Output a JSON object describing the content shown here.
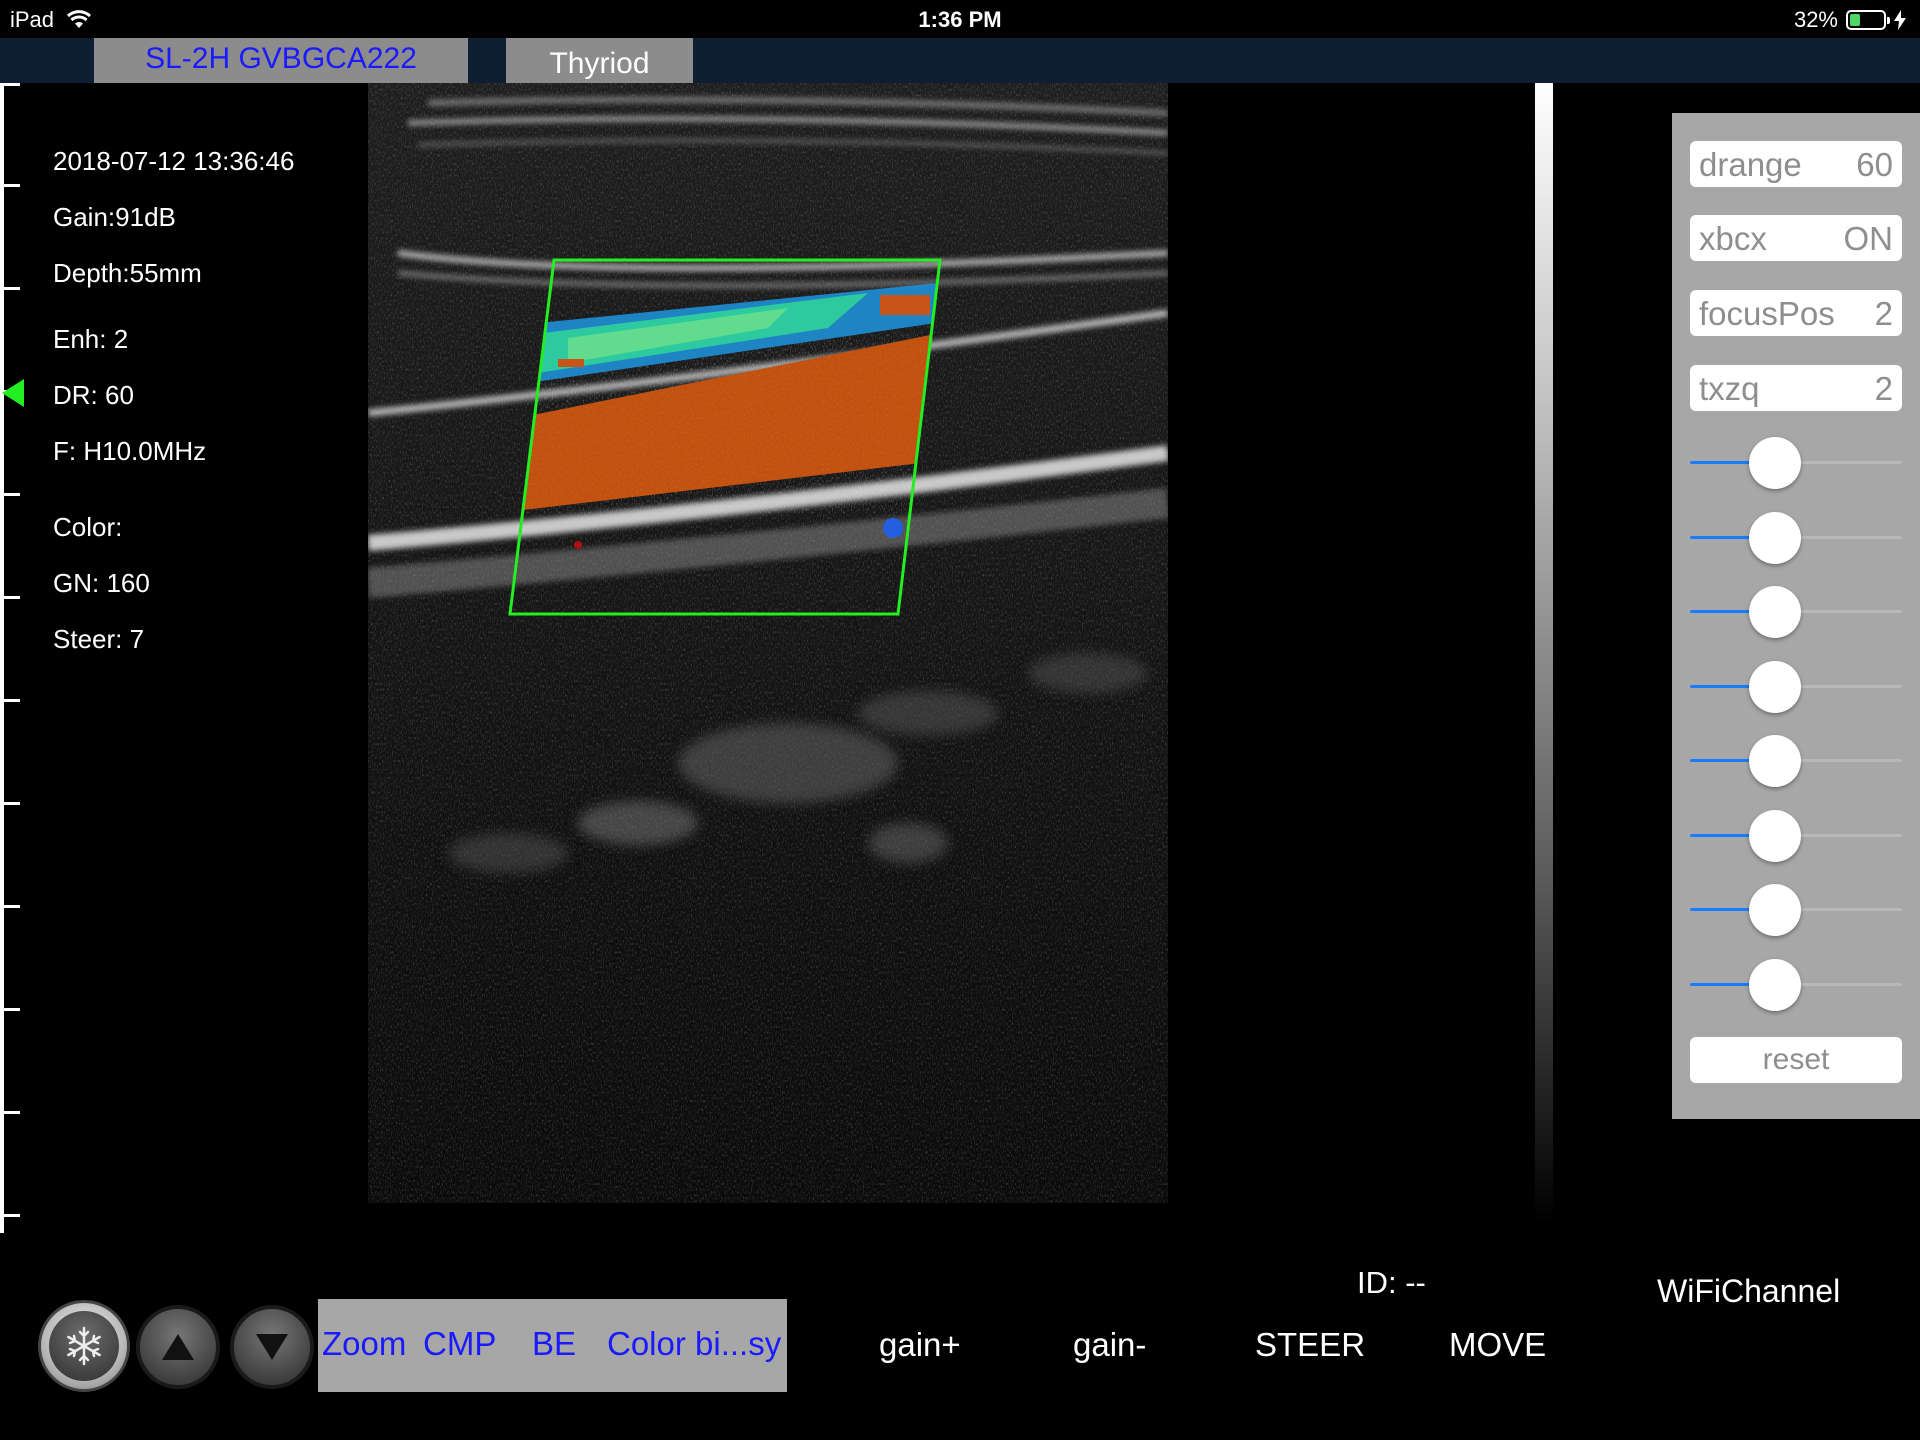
{
  "status_bar": {
    "device": "iPad",
    "time": "1:36 PM",
    "battery_percent": "32%",
    "battery_level": 0.32,
    "wifi_icon": "wifi-icon",
    "charging_icon": "bolt-icon"
  },
  "tabs": {
    "probe": "SL-2H GVBGCA222",
    "preset": "Thyriod"
  },
  "info": {
    "datetime": "2018-07-12 13:36:46",
    "gain": "Gain:91dB",
    "depth": "Depth:55mm",
    "enh": "Enh: 2",
    "dr": "DR: 60",
    "freq": "F: H10.0MHz",
    "color": "Color:",
    "gn": "GN: 160",
    "steer": "Steer: 7"
  },
  "panel": {
    "params": [
      {
        "label": "drange",
        "value": "60"
      },
      {
        "label": "xbcx",
        "value": "ON"
      },
      {
        "label": "focusPos",
        "value": "2"
      },
      {
        "label": "txzq",
        "value": "2"
      }
    ],
    "sliders": [
      0.4,
      0.4,
      0.4,
      0.4,
      0.4,
      0.4,
      0.4,
      0.4
    ],
    "reset_label": "reset"
  },
  "bottom": {
    "freeze_icon": "snowflake-icon",
    "up_icon": "triangle-up-icon",
    "down_icon": "triangle-down-icon",
    "modes": [
      "Zoom",
      "CMP",
      "BE",
      "Color bi...sy"
    ],
    "commands": [
      "gain+",
      "gain-",
      "STEER",
      "MOVE"
    ],
    "id_label": "ID: --",
    "wifi_channel": "WiFiChannel"
  },
  "colors": {
    "accent_blue": "#1a1aff",
    "roi_green": "#22ee22",
    "panel_gray": "#a7a7a7",
    "tabbar_navy": "#0e1f33"
  }
}
